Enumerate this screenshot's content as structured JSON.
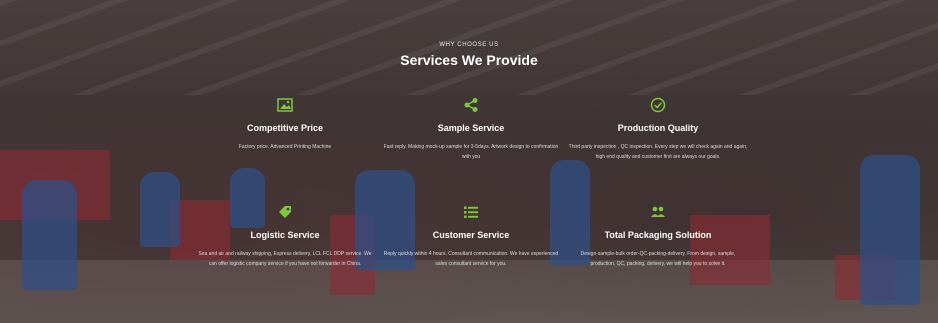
{
  "section": {
    "eyebrow": "WHY CHOOSE US",
    "title": "Services We Provide"
  },
  "accent_color": "#7ec83a",
  "services": [
    {
      "icon": "image-icon",
      "title": "Competitive Price",
      "description": "Factory price. Advanced Printing Machine"
    },
    {
      "icon": "share-icon",
      "title": "Sample Service",
      "description": "Fast reply. Making mock-up sample for 3-5days. Artwork design to confirmation with you"
    },
    {
      "icon": "check-circle-icon",
      "title": "Production Quality",
      "description": "Third party inspection , QC inspection. Every step we will check again and again, high end quality and customer first are always our goals."
    },
    {
      "icon": "tag-icon",
      "title": "Logistic Service",
      "description": "Sea and air and railway shipping, Express delivery, LCL FCL DDP service. We can offer logistic company service if you have not forwarder in China."
    },
    {
      "icon": "list-icon",
      "title": "Customer Service",
      "description": "Reply quickly within 4 hours. Consultant communication. We have experienced sales consultant service for you."
    },
    {
      "icon": "people-icon",
      "title": "Total Packaging Solution",
      "description": "Design-sample-bulk order-QC-packing-delivery. From design, sample, production, QC, packing, delivery, we will help you to solve it."
    }
  ]
}
